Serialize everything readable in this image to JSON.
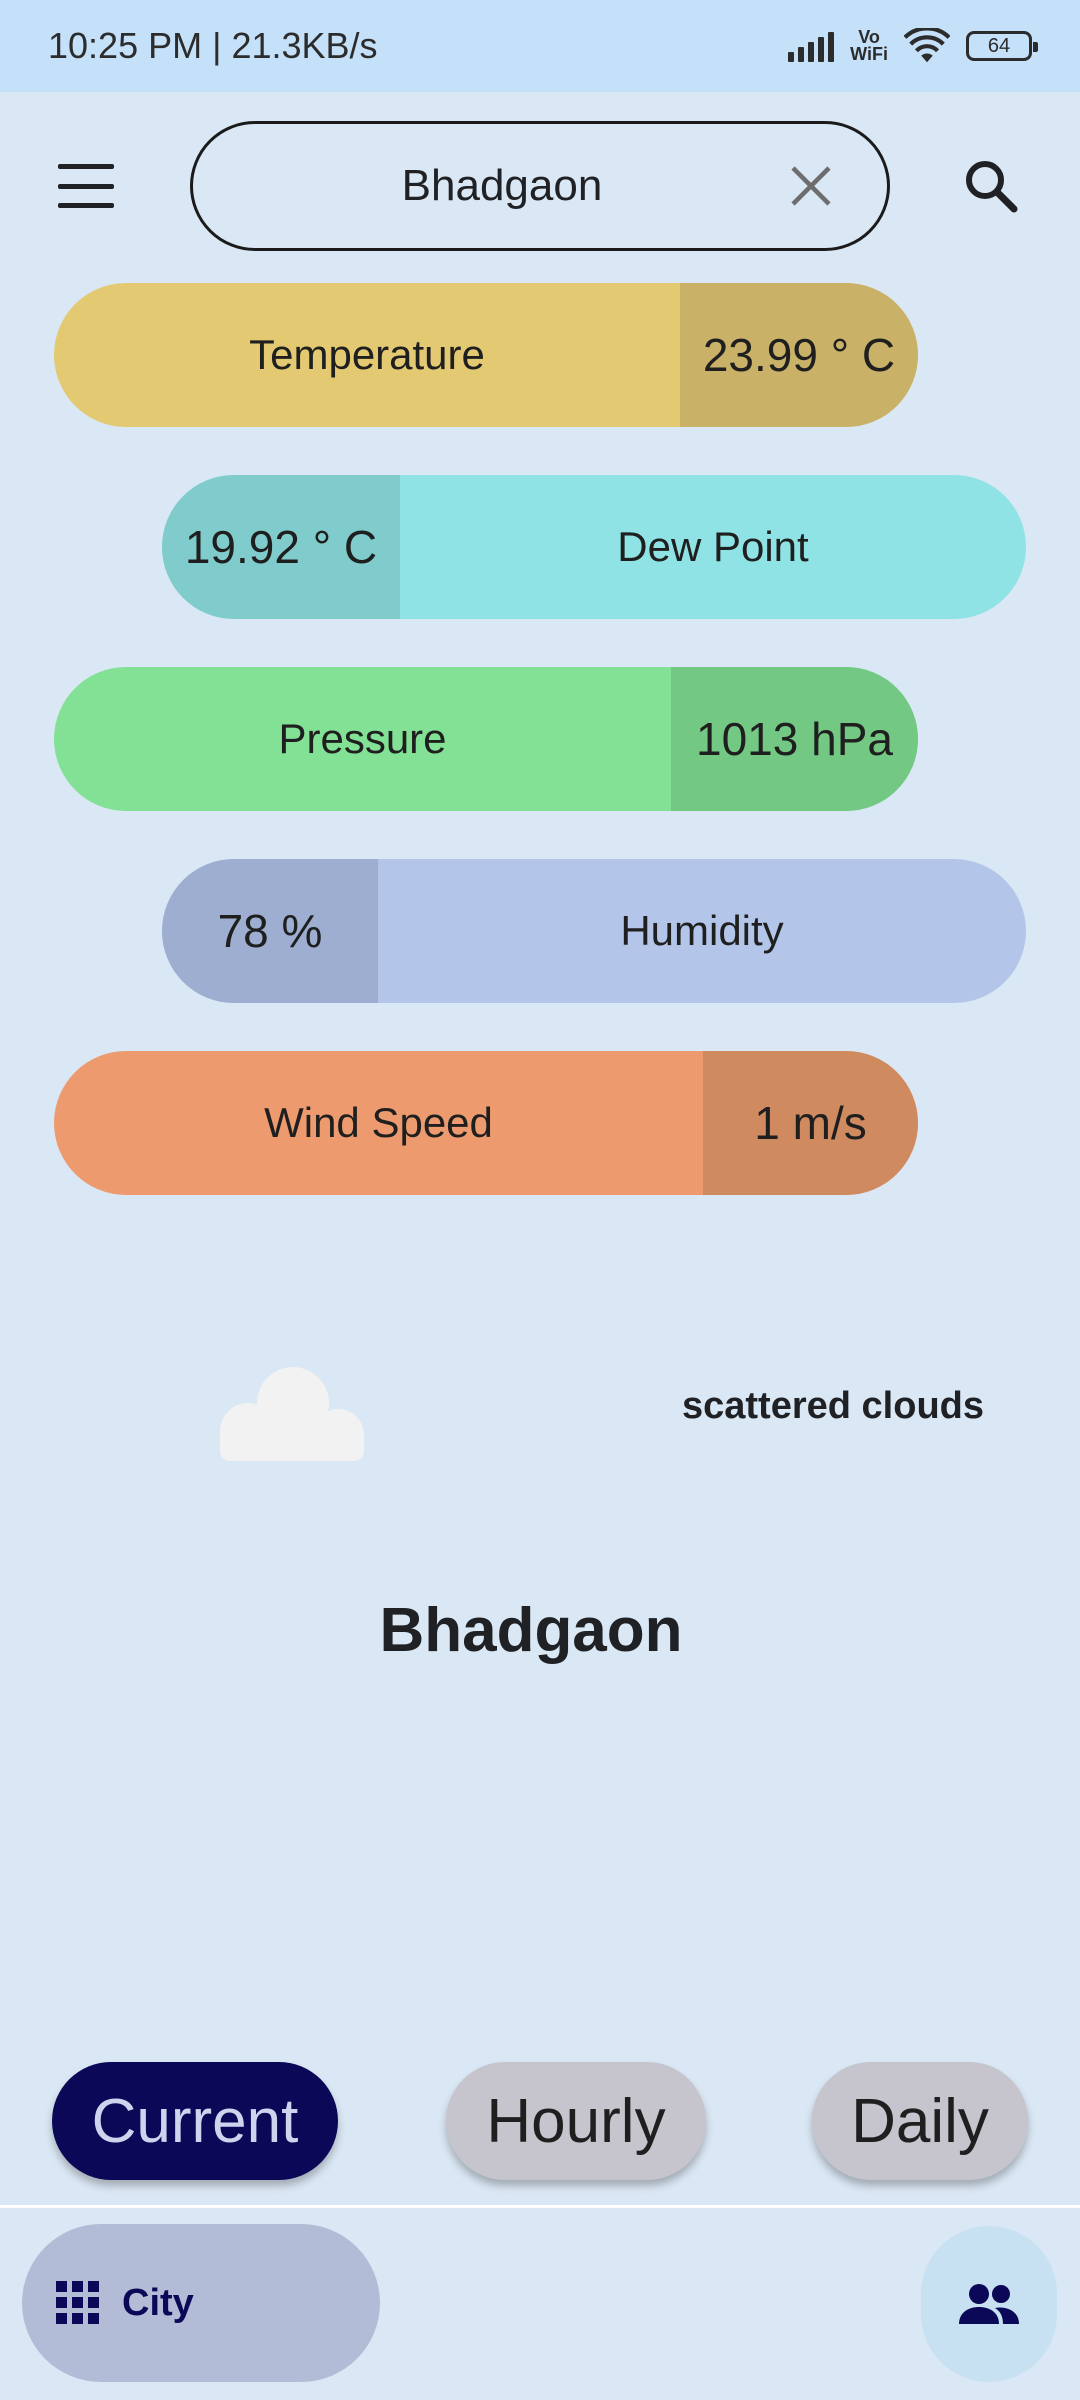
{
  "status_bar": {
    "time_speed": "10:25 PM | 21.3KB/s",
    "vowifi_top": "Vo",
    "vowifi_bottom": "WiFi",
    "battery": "64"
  },
  "search": {
    "value": "Bhadgaon"
  },
  "weather": {
    "temperature": {
      "label": "Temperature",
      "value": "23.99 ° C"
    },
    "dew_point": {
      "label": "Dew Point",
      "value": "19.92 ° C"
    },
    "pressure": {
      "label": "Pressure",
      "value": "1013 hPa"
    },
    "humidity": {
      "label": "Humidity",
      "value": "78 %"
    },
    "wind_speed": {
      "label": "Wind Speed",
      "value": "1 m/s"
    }
  },
  "condition": {
    "icon": "cloud-icon",
    "text": "scattered clouds"
  },
  "city_name": "Bhadgaon",
  "period_tabs": {
    "current": "Current",
    "hourly": "Hourly",
    "daily": "Daily"
  },
  "bottom_nav": {
    "city_label": "City",
    "city_icon": "grid-icon",
    "people_icon": "people-icon"
  },
  "colors": {
    "background": "#dae7f4",
    "temperature": "#e3ca72",
    "dew_point": "#8fe3e5",
    "pressure": "#82e195",
    "humidity": "#b3c6e9",
    "wind_speed": "#ed9b6e",
    "active_tab": "#0b0857"
  }
}
